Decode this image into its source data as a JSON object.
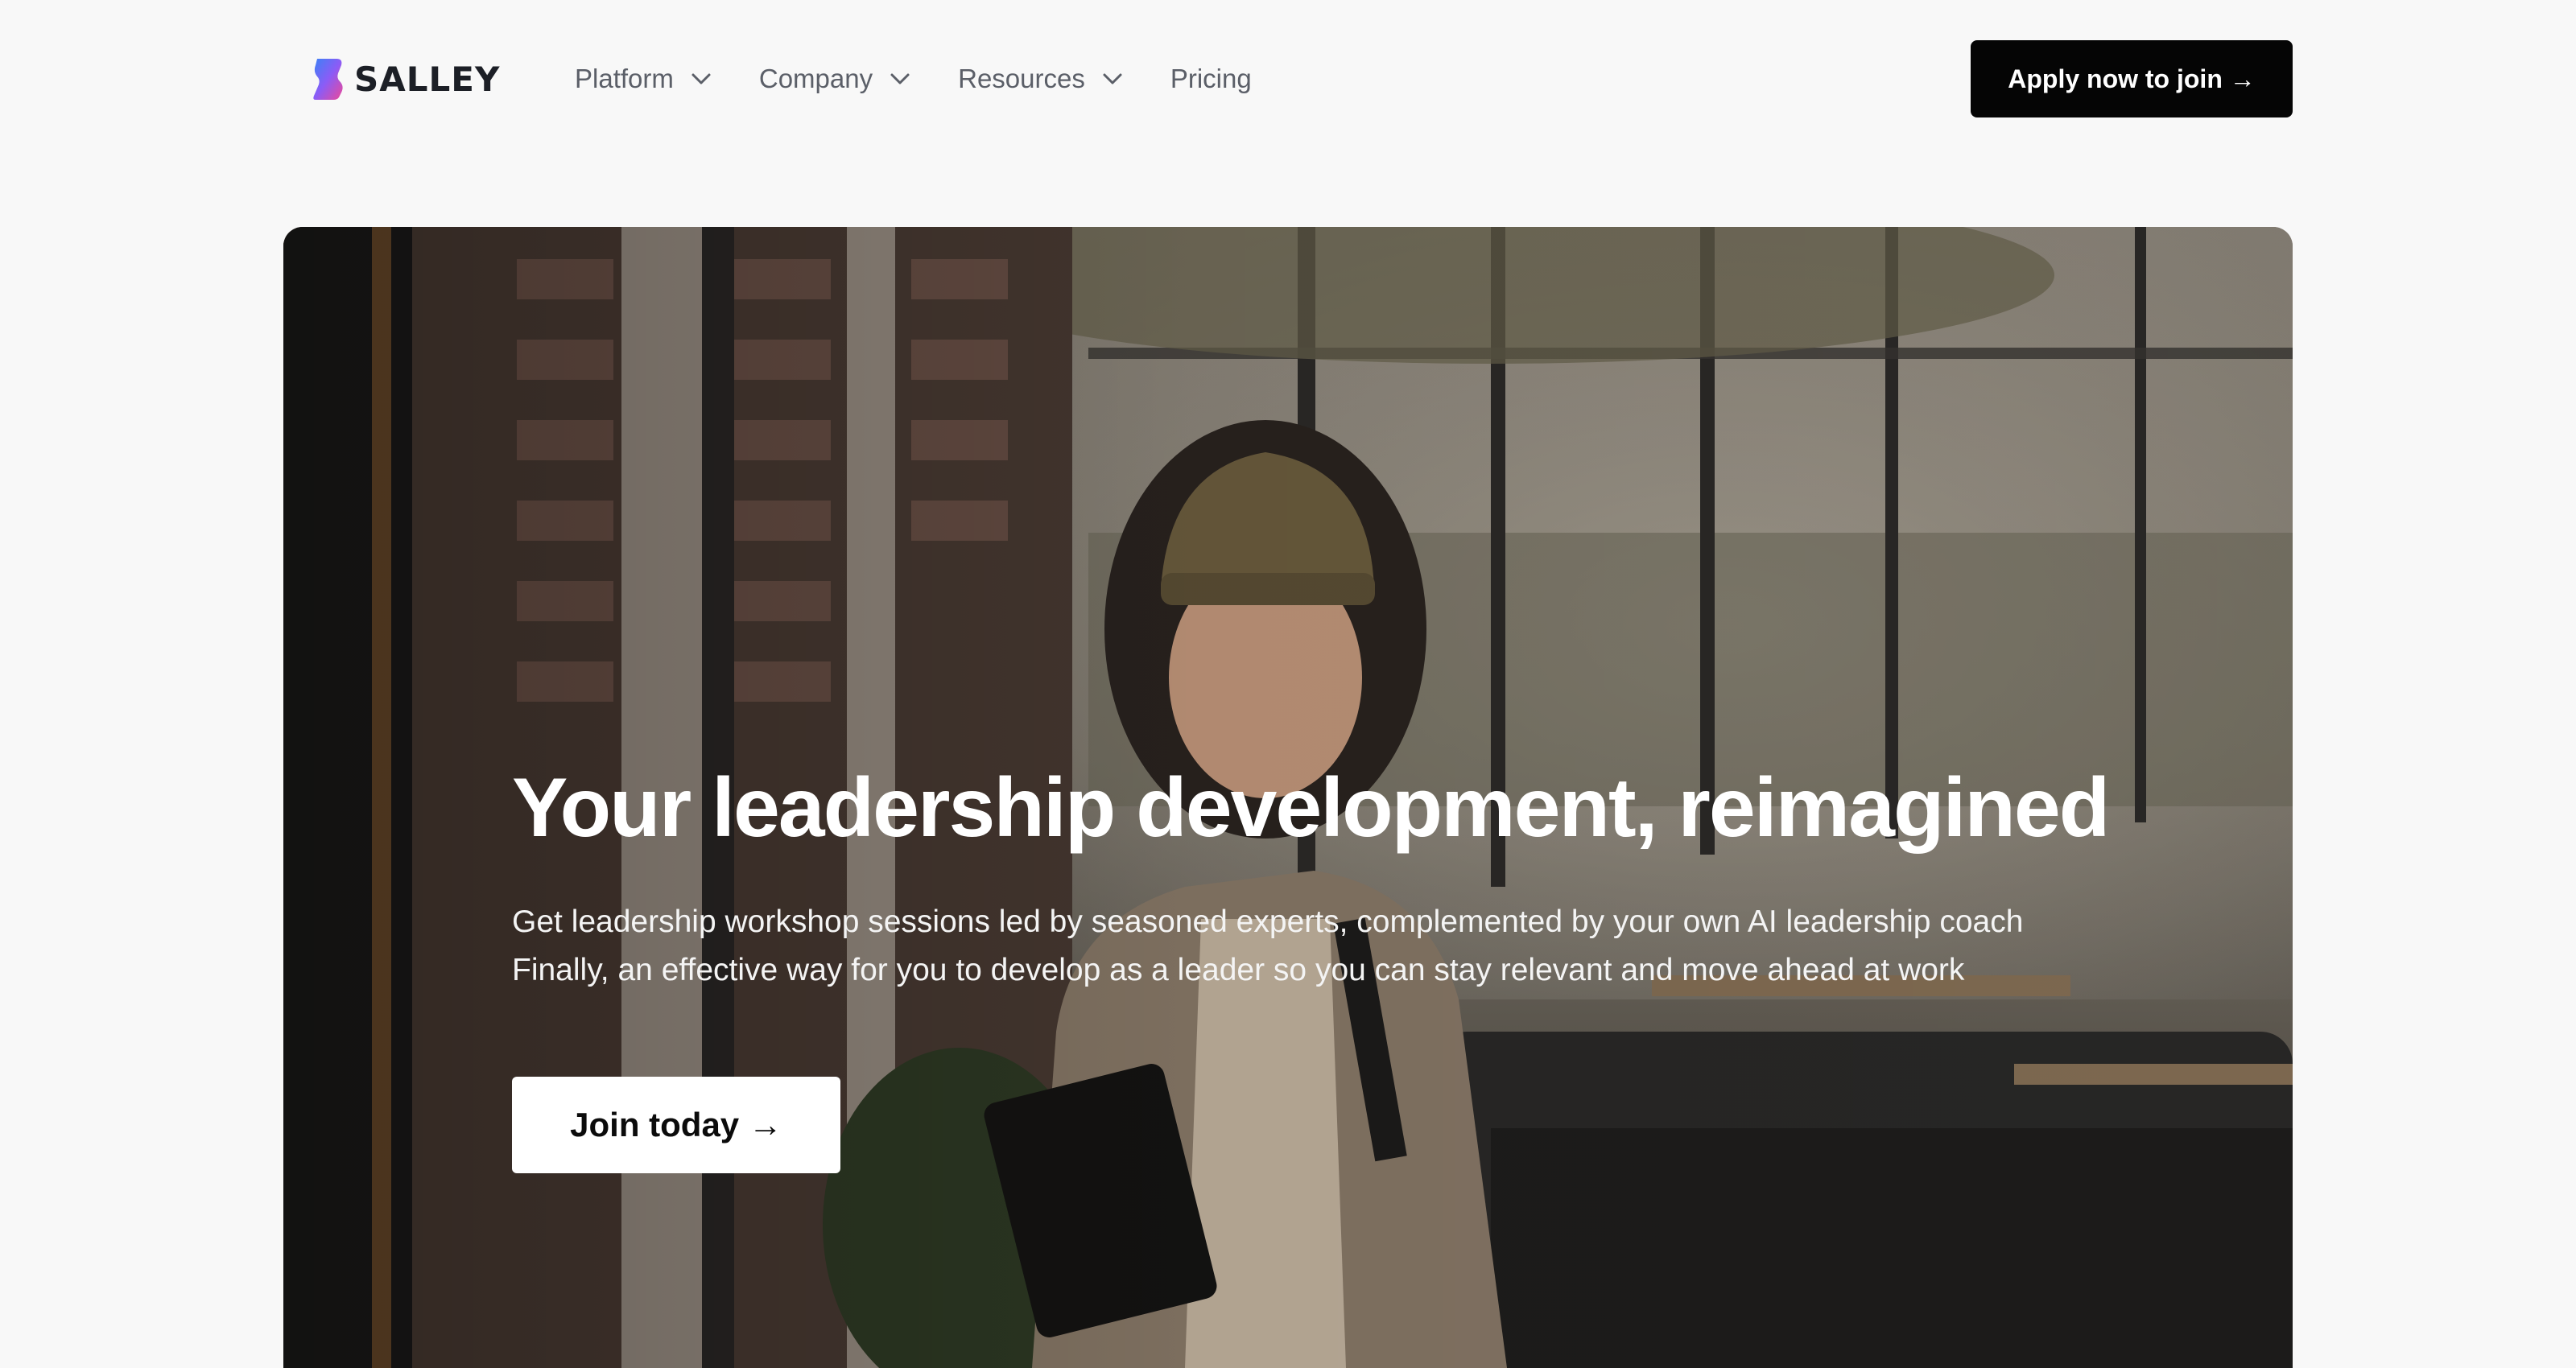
{
  "header": {
    "logo_text": "SALLEY",
    "logo_icon": "salley-logo-icon",
    "nav": [
      {
        "label": "Platform",
        "has_dropdown": true
      },
      {
        "label": "Company",
        "has_dropdown": true
      },
      {
        "label": "Resources",
        "has_dropdown": true
      },
      {
        "label": "Pricing",
        "has_dropdown": false
      }
    ],
    "cta_label": "Apply now to join →"
  },
  "hero": {
    "title": "Your leadership development, reimagined",
    "line1": "Get leadership workshop sessions led by seasoned experts, complemented by your own AI leadership coach",
    "line2": "Finally, an effective way for you to develop as a leader so you can stay relevant and move ahead at work",
    "cta_label": "Join today →",
    "image": "hero-photo-woman-with-laptop"
  },
  "colors": {
    "page_bg": "#f8f8f8",
    "cta_bg": "#050505",
    "nav_text": "#5b5f68",
    "logo_gradient_top": "#a855f7",
    "logo_gradient_bottom": "#3b82f6"
  }
}
